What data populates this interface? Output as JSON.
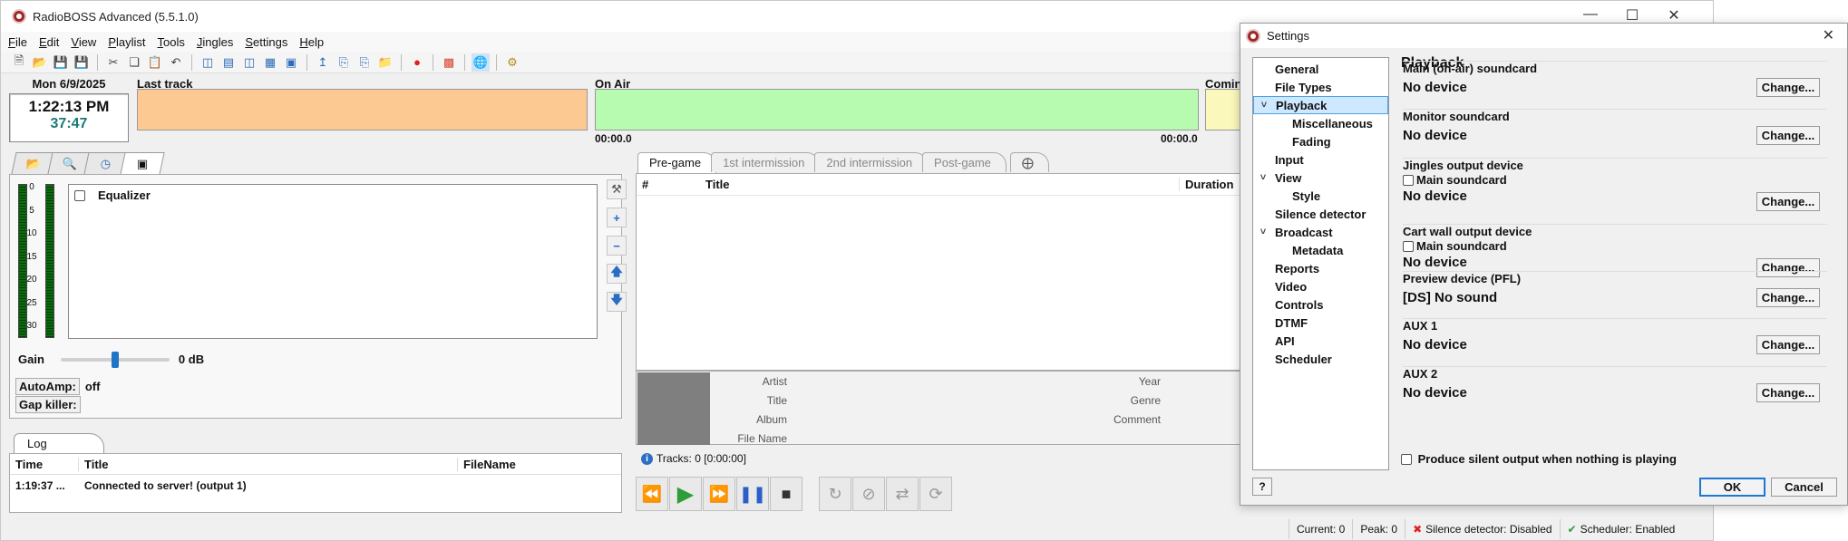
{
  "app": {
    "title": "RadioBOSS Advanced (5.5.1.0)",
    "window_controls": [
      "—",
      "☐",
      "✕"
    ]
  },
  "menu": [
    "File",
    "Edit",
    "View",
    "Playlist",
    "Tools",
    "Jingles",
    "Settings",
    "Help"
  ],
  "toolbar_icons": [
    "new-file-icon",
    "open-folder-icon",
    "save-icon",
    "save-as-icon",
    "cut-icon",
    "copy-icon",
    "paste-icon",
    "undo-icon",
    "layout1-icon",
    "layout2-icon",
    "layout3-icon",
    "layout4-icon",
    "layout5-icon",
    "insert-icon",
    "insert-after-icon",
    "insert-list-icon",
    "open-list-icon",
    "record-icon",
    "stats-icon",
    "globe-icon",
    "settings-gear-icon"
  ],
  "header": {
    "date": "Mon 6/9/2025",
    "time": "1:22:13 PM",
    "remaining": "37:47",
    "last_track_label": "Last track",
    "on_air_label": "On Air",
    "coming_label": "Comin",
    "onair_start": "00:00.0",
    "onair_end": "00:00.0"
  },
  "left_panel": {
    "vu_scale": [
      "0",
      "5",
      "10",
      "15",
      "20",
      "25",
      "30"
    ],
    "equalizer_label": "Equalizer",
    "gain_label": "Gain",
    "gain_value": "0 dB",
    "gain_level": 0.5,
    "autoamp_label": "AutoAmp:",
    "autoamp_value": "off",
    "gapkiller_label": "Gap killer:"
  },
  "log": {
    "tab": "Log",
    "columns": [
      "Time",
      "Title",
      "FileName"
    ],
    "rows": [
      {
        "time": "1:19:37 ...",
        "title": "Connected to server! (output 1)",
        "file": ""
      }
    ]
  },
  "playlist": {
    "tabs": [
      "Pre-game",
      "1st intermission",
      "2nd intermission",
      "Post-game"
    ],
    "active_tab": 0,
    "columns": [
      "#",
      "Title",
      "Duration"
    ],
    "info_labels": {
      "artist": "Artist",
      "title": "Title",
      "album": "Album",
      "filename": "File Name",
      "year": "Year",
      "genre": "Genre",
      "comment": "Comment"
    },
    "tracks": "Tracks: 0 [0:00:00]"
  },
  "status": {
    "current": "Current: 0",
    "peak": "Peak: 0",
    "silence": "Silence detector: Disabled",
    "scheduler": "Scheduler: Enabled"
  },
  "settings": {
    "title": "Settings",
    "tree": [
      {
        "label": "General",
        "level": 0,
        "arrow": ""
      },
      {
        "label": "File Types",
        "level": 0,
        "arrow": ""
      },
      {
        "label": "Playback",
        "level": 0,
        "arrow": "˅",
        "selected": true
      },
      {
        "label": "Miscellaneous",
        "level": 1,
        "arrow": ""
      },
      {
        "label": "Fading",
        "level": 1,
        "arrow": ""
      },
      {
        "label": "Input",
        "level": 0,
        "arrow": ""
      },
      {
        "label": "View",
        "level": 0,
        "arrow": "˅"
      },
      {
        "label": "Style",
        "level": 1,
        "arrow": ""
      },
      {
        "label": "Silence detector",
        "level": 0,
        "arrow": ""
      },
      {
        "label": "Broadcast",
        "level": 0,
        "arrow": "˅"
      },
      {
        "label": "Metadata",
        "level": 1,
        "arrow": ""
      },
      {
        "label": "Reports",
        "level": 0,
        "arrow": ""
      },
      {
        "label": "Video",
        "level": 0,
        "arrow": ""
      },
      {
        "label": "Controls",
        "level": 0,
        "arrow": ""
      },
      {
        "label": "DTMF",
        "level": 0,
        "arrow": ""
      },
      {
        "label": "API",
        "level": 0,
        "arrow": ""
      },
      {
        "label": "Scheduler",
        "level": 0,
        "arrow": ""
      }
    ],
    "pane_title": "Playback",
    "groups": [
      {
        "title": "Main (on-air) soundcard",
        "checkbox": "",
        "value": "No device"
      },
      {
        "title": "Monitor soundcard",
        "checkbox": "",
        "value": "No device"
      },
      {
        "title": "Jingles output device",
        "checkbox": "Main soundcard",
        "value": "No device"
      },
      {
        "title": "Cart wall output device",
        "checkbox": "Main soundcard",
        "value": "No device"
      },
      {
        "title": "Preview device (PFL)",
        "checkbox": "",
        "value": "[DS] No sound"
      },
      {
        "title": "AUX 1",
        "checkbox": "",
        "value": "No device"
      },
      {
        "title": "AUX 2",
        "checkbox": "",
        "value": "No device"
      }
    ],
    "change_label": "Change...",
    "silent_output": "Produce silent output when nothing is playing",
    "help": "?",
    "ok": "OK",
    "cancel": "Cancel"
  }
}
